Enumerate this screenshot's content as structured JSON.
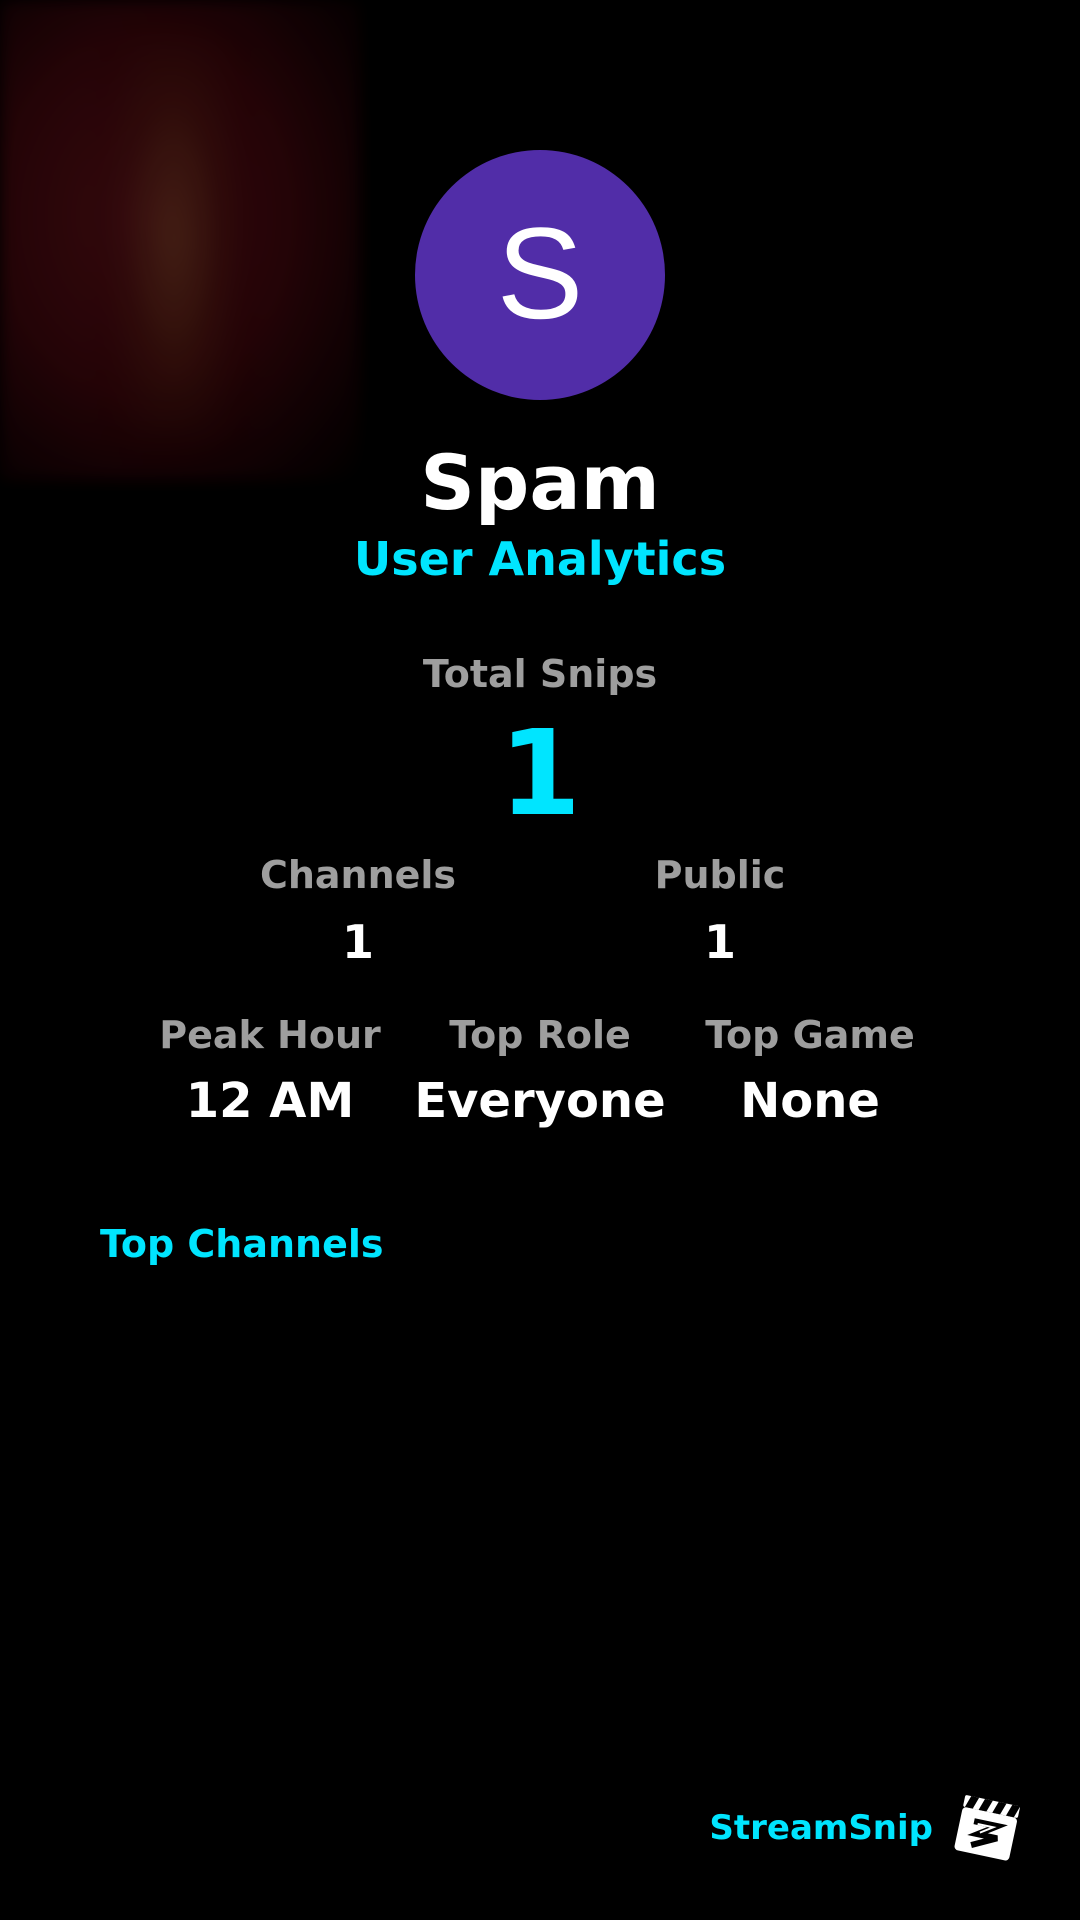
{
  "profile": {
    "avatar_letter": "S",
    "avatar_color": "#512da8",
    "name": "Spam",
    "subtitle": "User Analytics"
  },
  "stats": {
    "total_snips": {
      "label": "Total Snips",
      "value": "1"
    },
    "channels": {
      "label": "Channels",
      "value": "1"
    },
    "public": {
      "label": "Public",
      "value": "1"
    },
    "peak_hour": {
      "label": "Peak Hour",
      "value": "12 AM"
    },
    "top_role": {
      "label": "Top Role",
      "value": "Everyone"
    },
    "top_game": {
      "label": "Top Game",
      "value": "None"
    }
  },
  "sections": {
    "top_channels_title": "Top Channels"
  },
  "brand": {
    "name": "StreamSnip",
    "logo_icon": "clapperboard-icon",
    "accent_color": "#00e5ff"
  }
}
